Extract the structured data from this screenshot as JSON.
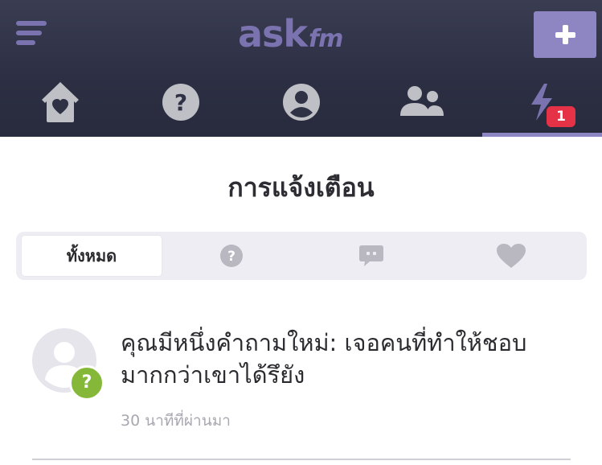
{
  "header": {
    "logo_main": "ask",
    "logo_sub": "fm",
    "add_label": "+",
    "notification_count": "1",
    "tabs": [
      "home",
      "questions",
      "profile",
      "friends",
      "notifications"
    ]
  },
  "page": {
    "title": "การแจ้งเตือน"
  },
  "filters": {
    "all_label": "ทั้งหมด",
    "items": [
      "all",
      "questions",
      "answers",
      "likes"
    ]
  },
  "notifications": [
    {
      "text": "คุณมีหนึ่งคำถามใหม่: เจอคนที่ทำให้ชอบมากกว่าเขาได้รึยัง",
      "badge": "?",
      "time": "30 นาทีที่ผ่านมา"
    }
  ],
  "colors": {
    "header_bg": "#2c2f43",
    "accent": "#7b73b0",
    "badge_red": "#e63247",
    "question_green": "#85b838"
  },
  "icons": {
    "menu": "hamburger-icon",
    "home": "home-heart-icon",
    "questions": "question-circle-icon",
    "profile": "user-circle-icon",
    "friends": "users-icon",
    "notifications": "lightning-icon",
    "answers": "chat-bubble-icon",
    "likes": "heart-icon"
  }
}
